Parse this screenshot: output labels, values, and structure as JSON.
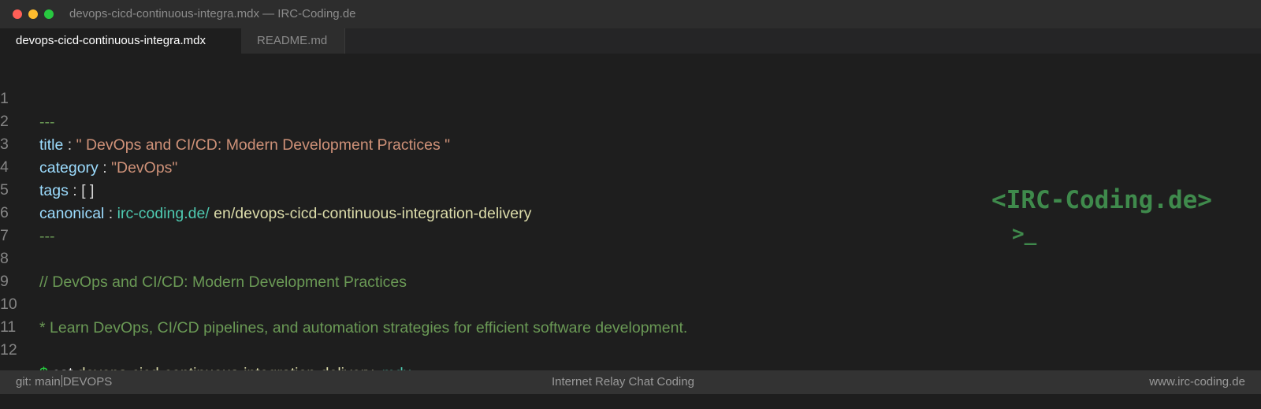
{
  "window": {
    "title": "devops-cicd-continuous-integra.mdx — IRC-Coding.de"
  },
  "tabs": [
    {
      "label": "devops-cicd-continuous-integra.mdx",
      "active": true
    },
    {
      "label": "README.md",
      "active": false
    }
  ],
  "editor": {
    "line_numbers": [
      "1",
      "2",
      "3",
      "4",
      "5",
      "6",
      "7",
      "8",
      "9",
      "10",
      "11",
      "12"
    ],
    "frontmatter_delimiter": "---",
    "title_key": "title",
    "title_value": "\" DevOps and CI/CD: Modern Development Practices \"",
    "category_key": "category",
    "category_value": "\"DevOps\"",
    "tags_key": "tags",
    "tags_value": "[ ]",
    "canonical_key": "canonical",
    "canonical_domain": "irc-coding.de/",
    "canonical_path": "en/devops-cicd-continuous-integration-delivery",
    "comment_line": "// DevOps and CI/CD: Modern Development Practices",
    "description_line": "* Learn DevOps, CI/CD pipelines, and automation strategies for efficient software development.",
    "prompt_symbol": "$",
    "command": "cat",
    "command_file": "devops-cicd-continuous-integration-delivery",
    "command_ext": ".mdx"
  },
  "logo": {
    "text": "<IRC-Coding.de>",
    "prompt": ">_"
  },
  "statusbar": {
    "branch": "git: main",
    "project": "DEVOPS",
    "center": "Internet Relay Chat Coding",
    "right": "www.irc-coding.de"
  },
  "colors": {
    "background": "#1e1e1e",
    "comment": "#6a9955",
    "key": "#9cdcfe",
    "string": "#ce9178",
    "url": "#4ec9b0",
    "path": "#dcdcaa",
    "logo": "#3f8a4c"
  }
}
